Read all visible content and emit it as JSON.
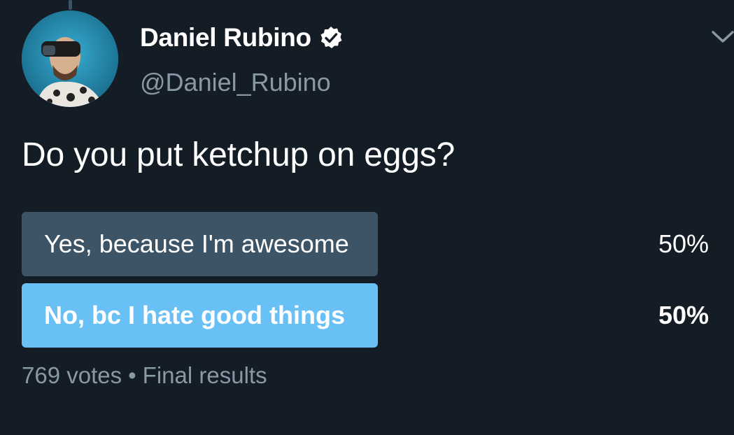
{
  "tweet": {
    "author": {
      "display_name": "Daniel Rubino",
      "handle": "@Daniel_Rubino",
      "verified": true,
      "avatar_icon": "profile-photo"
    },
    "question": "Do you put ketchup on eggs?",
    "poll": {
      "options": [
        {
          "label": "Yes, because I'm awesome",
          "percent_text": "50%",
          "percent": 50,
          "winner": false
        },
        {
          "label": "No, bc I hate good things",
          "percent_text": "50%",
          "percent": 50,
          "winner": true
        }
      ],
      "votes": "769 votes",
      "separator": "•",
      "status": "Final results"
    },
    "menu_icon": "chevron-down-icon"
  },
  "colors": {
    "background": "#141d26",
    "secondary_text": "#8899a6",
    "bar_default": "#3d5466",
    "bar_winner": "#69c0f5"
  }
}
